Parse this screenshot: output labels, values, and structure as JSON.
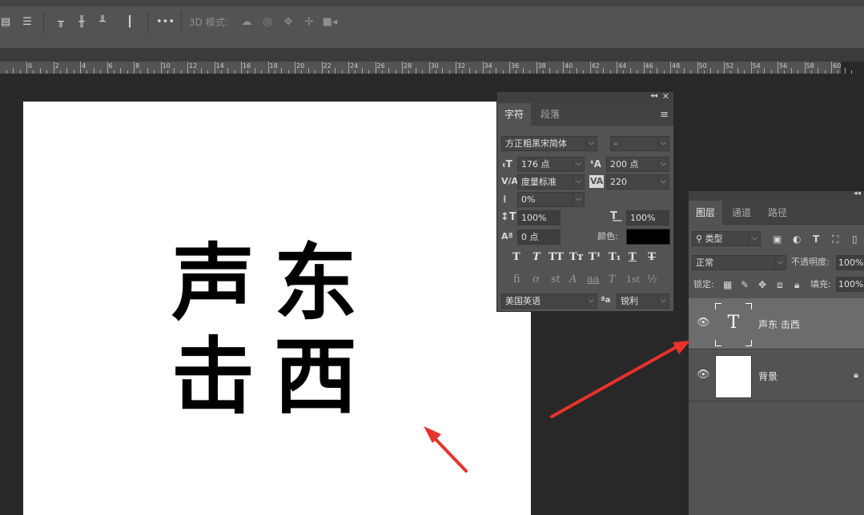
{
  "options_bar": {
    "label_3d_mode": "3D 模式:",
    "more_label": "•••",
    "icons": [
      "align-left-edges-icon",
      "align-centers-icon",
      "align-top-edges-icon",
      "align-vertical-centers-icon",
      "align-bottom-edges-icon",
      "distribute-icon",
      "rotate-3d-icon",
      "roll-3d-icon",
      "drag-3d-icon",
      "slide-3d-icon",
      "scale-3d-icon"
    ]
  },
  "ruler": {
    "labels": [
      "0",
      "2",
      "4",
      "6",
      "8",
      "10",
      "12",
      "14",
      "16",
      "18",
      "20",
      "22",
      "24",
      "26",
      "28",
      "30",
      "32",
      "34",
      "36",
      "38",
      "40",
      "42",
      "44",
      "46",
      "48",
      "50",
      "52",
      "54",
      "56",
      "58",
      "60"
    ]
  },
  "canvas": {
    "text_lines": [
      "声 东",
      "击 西"
    ],
    "char1": "声",
    "char2": "东",
    "char3": "击",
    "char4": "西"
  },
  "character_panel": {
    "collapse_icon": "◂◂",
    "close_icon": "✕",
    "tabs": [
      {
        "label": "字符",
        "active": true
      },
      {
        "label": "段落",
        "active": false
      }
    ],
    "font_family": "方正粗黑宋简体",
    "font_style": "-",
    "font_size": "176 点",
    "leading": "200 点",
    "kerning": "度量标准",
    "tracking": "220",
    "tsume": "0%",
    "vertical_scale": "100%",
    "horizontal_scale": "100%",
    "baseline_shift": "0 点",
    "color_label": "颜色:",
    "color_value": "#000000",
    "text_styles": [
      "T",
      "T",
      "TT",
      "Tт",
      "T¹",
      "T₁",
      "T",
      "T"
    ],
    "opentype": [
      "fi",
      "ơ",
      "st",
      "A",
      "aa",
      "T",
      "1st",
      "½"
    ],
    "language": "美国英语",
    "antialias_icon": "ªa",
    "antialias": "锐利"
  },
  "layers_panel": {
    "tabs": [
      {
        "label": "图层",
        "active": true
      },
      {
        "label": "通道",
        "active": false
      },
      {
        "label": "路径",
        "active": false
      }
    ],
    "filter_label": "类型",
    "blend_mode": "正常",
    "opacity_label": "不透明度:",
    "opacity_value": "100%",
    "lock_label": "锁定:",
    "fill_label": "填充:",
    "fill_value": "100%",
    "layers": [
      {
        "name": "声东 击西",
        "type": "text",
        "selected": true,
        "thumb_glyph": "T"
      },
      {
        "name": "背景",
        "type": "background",
        "selected": false,
        "locked": true
      }
    ]
  },
  "annotations": {
    "arrow_color": "#e8322b"
  }
}
